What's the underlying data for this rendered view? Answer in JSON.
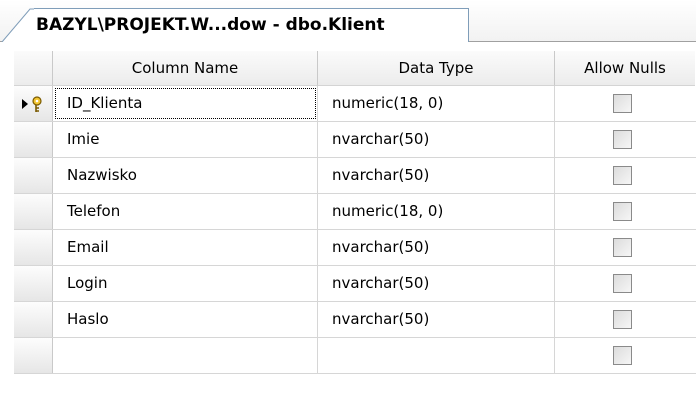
{
  "tab": {
    "title": "BAZYL\\PROJEKT.W...dow - dbo.Klient"
  },
  "columns": {
    "name": "Column Name",
    "type": "Data Type",
    "nulls": "Allow Nulls"
  },
  "rows": [
    {
      "name": "ID_Klienta",
      "type": "numeric(18, 0)",
      "allow_nulls": false,
      "primary_key": true
    },
    {
      "name": "Imie",
      "type": "nvarchar(50)",
      "allow_nulls": false
    },
    {
      "name": "Nazwisko",
      "type": "nvarchar(50)",
      "allow_nulls": false
    },
    {
      "name": "Telefon",
      "type": "numeric(18, 0)",
      "allow_nulls": false
    },
    {
      "name": "Email",
      "type": "nvarchar(50)",
      "allow_nulls": false
    },
    {
      "name": "Login",
      "type": "nvarchar(50)",
      "allow_nulls": false
    },
    {
      "name": "Haslo",
      "type": "nvarchar(50)",
      "allow_nulls": false
    },
    {
      "name": "",
      "type": "",
      "allow_nulls": false
    }
  ],
  "icons": {
    "row_indicator": "current-row-arrow-icon",
    "primary_key": "key-icon"
  }
}
